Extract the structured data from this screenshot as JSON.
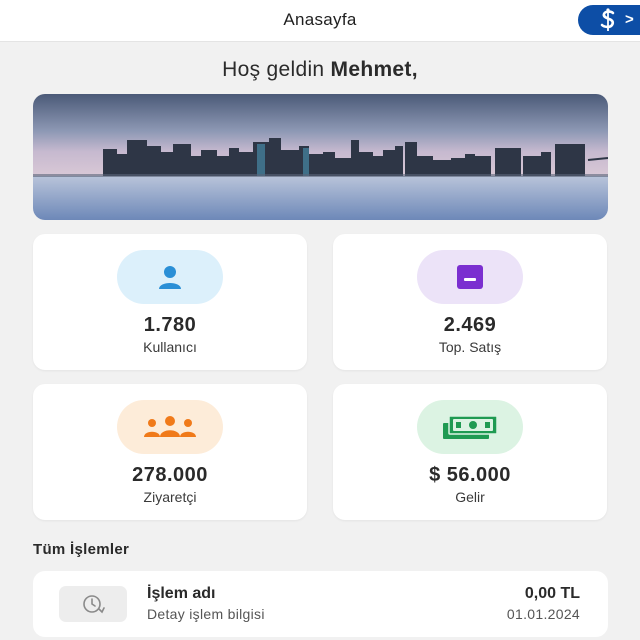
{
  "header": {
    "title": "Anasayfa",
    "logo_icon": "isbank-logo-icon",
    "chevron": ">",
    "brand_color": "#0d4ea6"
  },
  "greeting": {
    "prefix": "Hoş geldin ",
    "name": "Mehmet,"
  },
  "hero": {
    "image": "city-skyline-photo"
  },
  "stats": [
    {
      "value": "1.780",
      "label": "Kullanıcı",
      "icon": "user-icon",
      "icon_color": "#2a8fd6",
      "bg_color": "#dcf0fb"
    },
    {
      "value": "2.469",
      "label": "Top. Satış",
      "icon": "box-icon",
      "icon_color": "#7b2fd0",
      "bg_color": "#ece3f8"
    },
    {
      "value": "278.000",
      "label": "Ziyaretçi",
      "icon": "users-group-icon",
      "icon_color": "#f07a1a",
      "bg_color": "#fdecd9"
    },
    {
      "value": "$ 56.000",
      "label": "Gelir",
      "icon": "cash-icon",
      "icon_color": "#1f9a52",
      "bg_color": "#dcf3e3"
    }
  ],
  "transactions": {
    "title": "Tüm İşlemler",
    "items": [
      {
        "name": "İşlem adı",
        "detail": "Detay işlem bilgisi",
        "amount": "0,00 TL",
        "date": "01.01.2024",
        "icon": "clock-history-icon"
      }
    ]
  }
}
